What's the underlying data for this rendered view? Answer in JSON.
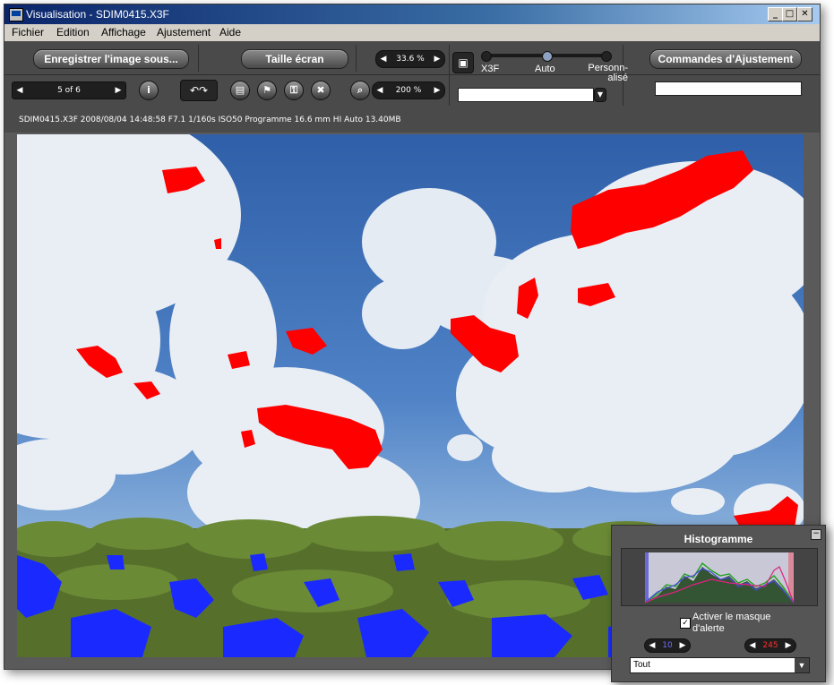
{
  "window": {
    "title": "Visualisation - SDIM0415.X3F",
    "minimize": "_",
    "maximize": "□",
    "close": "✕"
  },
  "menu": {
    "items": [
      "Fichier",
      "Edition",
      "Affichage",
      "Ajustement",
      "Aide"
    ]
  },
  "toolbar": {
    "save_label": "Enregistrer l'image sous...",
    "fullscreen_label": "Taille écran",
    "zoom_value": "33.6 %",
    "page_value": "5 of 6",
    "zoom2_value": "200 %",
    "adjust_label": "Commandes d'Ajustement",
    "mode_x3f": "X3F",
    "mode_auto": "Auto",
    "mode_custom": "Personn-\nalisé",
    "mode_selected": "Auto",
    "dropdown_value": "",
    "input_value": ""
  },
  "info": {
    "text": "SDIM0415.X3F 2008/08/04 14:48:58 F7.1 1/160s ISO50 Programme 16.6 mm HI Auto 13.40MB"
  },
  "histogram": {
    "title": "Histogramme",
    "checkbox_label": "Activer le masque d'alerte",
    "checked": true,
    "low_value": "10",
    "high_value": "245",
    "channel_value": "Tout"
  },
  "colors": {
    "alert_high": "#ff0000",
    "alert_low": "#0000ff",
    "chrome": "#4a4a4a"
  },
  "icons": {
    "info": "info-icon",
    "rotate_left": "rotate-left-icon",
    "rotate_right": "rotate-right-icon",
    "print": "print-icon",
    "flag": "flag-icon",
    "key": "key-icon",
    "trash": "trash-icon",
    "magnifier": "magnifier-icon"
  }
}
